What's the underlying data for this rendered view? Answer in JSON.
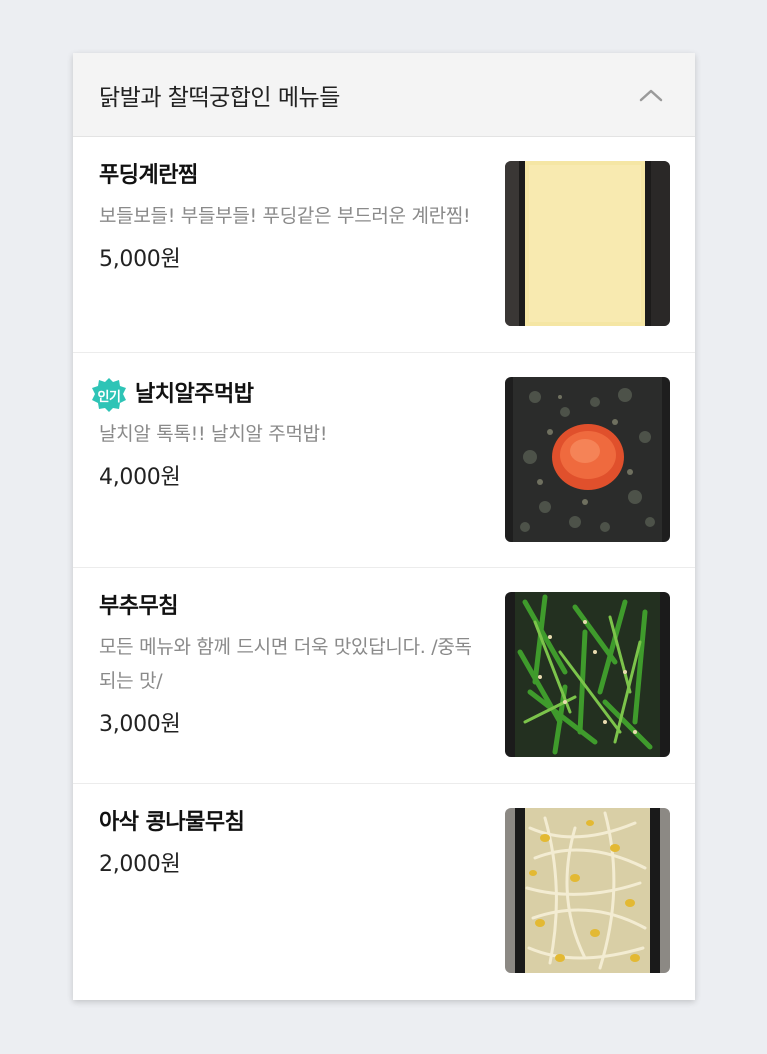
{
  "section": {
    "title": "닭발과 찰떡궁합인 메뉴들",
    "toggle_icon": "chevron-up-icon"
  },
  "menu": {
    "items": [
      {
        "name": "푸딩계란찜",
        "description": "보들보들! 부들부들! 푸딩같은 부드러운 계란찜!",
        "price": "5,000원",
        "image": "steamed-egg"
      },
      {
        "name": "날치알주먹밥",
        "badge": "인기",
        "description": "날치알 톡톡!! 날치알 주먹밥!",
        "price": "4,000원",
        "image": "roe-rice-ball"
      },
      {
        "name": "부추무침",
        "description": "모든 메뉴와 함께 드시면 더욱 맛있답니다. /중독되는 맛/",
        "price": "3,000원",
        "image": "chive-salad"
      },
      {
        "name": "아삭 콩나물무침",
        "price": "2,000원",
        "image": "bean-sprouts"
      }
    ]
  },
  "colors": {
    "badge": "#2ec4b6",
    "header_bg": "#f4f4f4",
    "page_bg": "#eceef2"
  }
}
